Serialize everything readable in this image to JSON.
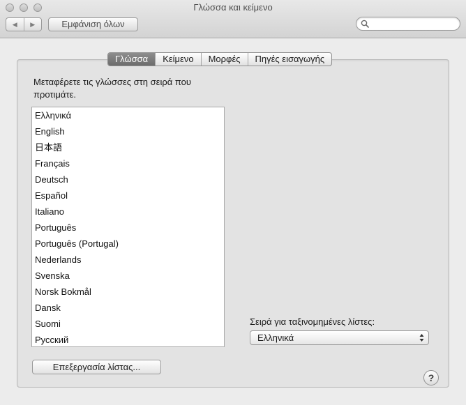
{
  "window": {
    "title": "Γλώσσα και κείμενο"
  },
  "toolbar": {
    "back_glyph": "◀",
    "forward_glyph": "▶",
    "show_all_label": "Εμφάνιση όλων",
    "search_placeholder": ""
  },
  "tabs": [
    {
      "label": "Γλώσσα",
      "active": true
    },
    {
      "label": "Κείμενο",
      "active": false
    },
    {
      "label": "Μορφές",
      "active": false
    },
    {
      "label": "Πηγές εισαγωγής",
      "active": false
    }
  ],
  "language": {
    "instruction": "Μεταφέρετε τις γλώσσες στη σειρά που προτιμάτε.",
    "languages": [
      "Ελληνικά",
      "English",
      "日本語",
      "Français",
      "Deutsch",
      "Español",
      "Italiano",
      "Português",
      "Português (Portugal)",
      "Nederlands",
      "Svenska",
      "Norsk Bokmål",
      "Dansk",
      "Suomi",
      "Русский"
    ],
    "edit_list_label": "Επεξεργασία λίστας...",
    "sort_order_label": "Σειρά για ταξινομημένες λίστες:",
    "sort_order_value": "Ελληνικά"
  },
  "help": {
    "label": "?"
  }
}
